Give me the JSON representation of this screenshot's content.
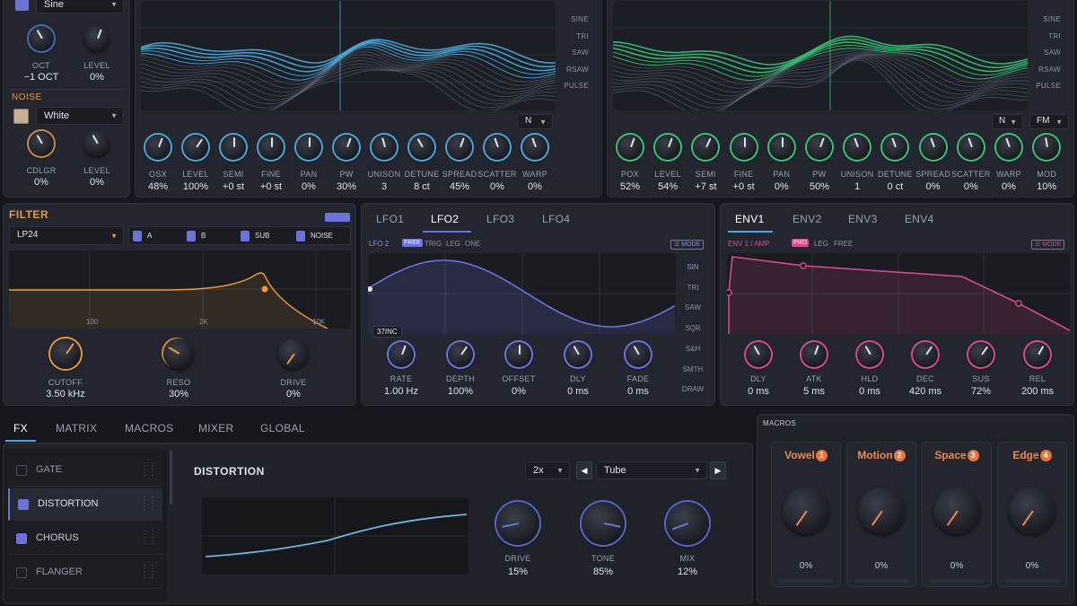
{
  "colors": {
    "osc_a": "#4aa8d8",
    "osc_b": "#37c474",
    "filter": "#e89a3c",
    "lfo": "#6d72e0",
    "env": "#d84a8c",
    "macro": "#f08a4b",
    "accent_square": "#6b73d9"
  },
  "osc_left": {
    "wave_select": "Sine",
    "knobs": [
      {
        "label": "OCT",
        "value": "−1 OCT"
      },
      {
        "label": "LEVEL",
        "value": "0%"
      }
    ],
    "noise_title": "NOISE",
    "noise_type": "White",
    "noise_knobs": [
      {
        "label": "CDLGR",
        "value": "0%"
      },
      {
        "label": "LEVEL",
        "value": "0%"
      }
    ]
  },
  "osc_a": {
    "waves": [
      "SINE",
      "TRI",
      "SAW",
      "RSAW",
      "PULSE"
    ],
    "mode": "N",
    "knobs": [
      {
        "label": "OSX",
        "value": "48%"
      },
      {
        "label": "LEVEL",
        "value": "100%"
      },
      {
        "label": "SEMI",
        "value": "+0 st"
      },
      {
        "label": "FINE",
        "value": "+0 st"
      },
      {
        "label": "PAN",
        "value": "0%"
      },
      {
        "label": "PW",
        "value": "30%"
      },
      {
        "label": "UNISON",
        "value": "3"
      },
      {
        "label": "DETUNE",
        "value": "8 ct"
      },
      {
        "label": "SPREAD",
        "value": "45%"
      },
      {
        "label": "SCATTER",
        "value": "0%"
      },
      {
        "label": "WARP",
        "value": "0%"
      }
    ]
  },
  "osc_b": {
    "waves": [
      "SINE",
      "TRI",
      "SAW",
      "RSAW",
      "PULSE"
    ],
    "mode": "N",
    "mode2": "FM",
    "knobs": [
      {
        "label": "POX",
        "value": "52%"
      },
      {
        "label": "LEVEL",
        "value": "54%"
      },
      {
        "label": "SEMI",
        "value": "+7 st"
      },
      {
        "label": "FINE",
        "value": "+0 st"
      },
      {
        "label": "PAN",
        "value": "0%"
      },
      {
        "label": "PW",
        "value": "50%"
      },
      {
        "label": "UNISON",
        "value": "1"
      },
      {
        "label": "DETUNE",
        "value": "0 ct"
      },
      {
        "label": "SPREAD",
        "value": "0%"
      },
      {
        "label": "SCATTER",
        "value": "0%"
      },
      {
        "label": "WARP",
        "value": "0%"
      },
      {
        "label": "MOD",
        "value": "10%"
      }
    ]
  },
  "filter": {
    "title": "FILTER",
    "type": "LP24",
    "routes": [
      "A",
      "B",
      "SUB",
      "NOISE"
    ],
    "freq_labels": [
      "100",
      "2K",
      "10K"
    ],
    "knobs": [
      {
        "label": "CUTOFF",
        "value": "3.50 kHz"
      },
      {
        "label": "RESO",
        "value": "30%"
      },
      {
        "label": "DRIVE",
        "value": "0%"
      }
    ]
  },
  "lfo": {
    "tabs": [
      "LFO1",
      "LFO2",
      "LFO3",
      "LFO4"
    ],
    "header": "LFO 2",
    "modes": [
      "FREE",
      "TRIG",
      "LEG",
      "ONE"
    ],
    "mode_btn": "MODE",
    "shapes": [
      "SIN",
      "TRI",
      "SAW",
      "SQR",
      "S&H",
      "SMTH",
      "DRAW"
    ],
    "sync_tag": "37INC",
    "knobs": [
      {
        "label": "RATE",
        "value": "1.00 Hz"
      },
      {
        "label": "DEPTH",
        "value": "100%"
      },
      {
        "label": "OFFSET",
        "value": "0%"
      },
      {
        "label": "DLY",
        "value": "0 ms"
      },
      {
        "label": "FADE",
        "value": "0 ms"
      }
    ]
  },
  "env": {
    "tabs": [
      "ENV1",
      "ENV2",
      "ENV3",
      "ENV4"
    ],
    "header": "ENV 1 / AMP",
    "modes": [
      "PRO",
      "LEG",
      "FREE"
    ],
    "mode_btn": "MODE",
    "knobs": [
      {
        "label": "DLY",
        "value": "0 ms"
      },
      {
        "label": "ATK",
        "value": "5 ms"
      },
      {
        "label": "HLD",
        "value": "0 ms"
      },
      {
        "label": "DEC",
        "value": "420 ms"
      },
      {
        "label": "SUS",
        "value": "72%"
      },
      {
        "label": "REL",
        "value": "200 ms"
      }
    ]
  },
  "bottom_tabs": [
    "FX",
    "MATRIX",
    "MACROS",
    "MIXER",
    "GLOBAL"
  ],
  "fx": {
    "items": [
      {
        "name": "GATE",
        "on": false
      },
      {
        "name": "DISTORTION",
        "on": true
      },
      {
        "name": "CHORUS",
        "on": true
      },
      {
        "name": "FLANGER",
        "on": false
      }
    ],
    "title": "DISTORTION",
    "oversample": "2x",
    "type": "Tube",
    "knobs": [
      {
        "label": "DRIVE",
        "value": "15%",
        "level": 0.15
      },
      {
        "label": "TONE",
        "value": "85%",
        "level": 0.85
      },
      {
        "label": "MIX",
        "value": "12%",
        "level": 0.12
      }
    ]
  },
  "macros": {
    "title": "MACROS",
    "items": [
      {
        "name": "Vowel",
        "num": "1",
        "value": "0%"
      },
      {
        "name": "Motion",
        "num": "2",
        "value": "0%"
      },
      {
        "name": "Space",
        "num": "3",
        "value": "0%"
      },
      {
        "name": "Edge",
        "num": "4",
        "value": "0%"
      }
    ]
  }
}
